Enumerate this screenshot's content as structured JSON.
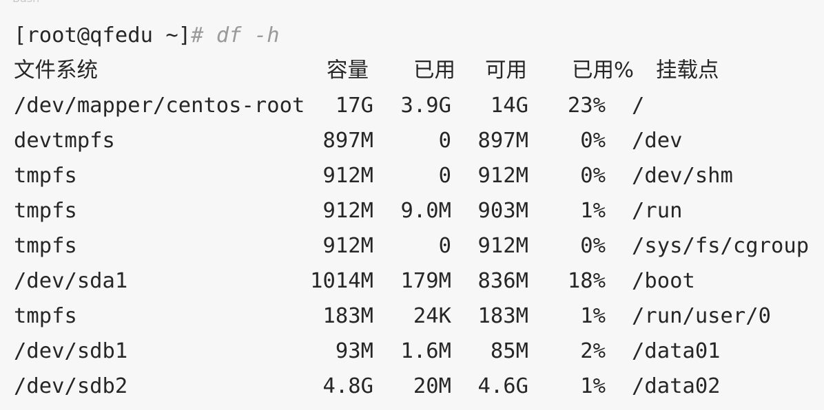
{
  "language_label": "Bash",
  "prompt": {
    "user_host": "[root@qfedu ~]",
    "hash": "#",
    "command": "df -h"
  },
  "table": {
    "headers": {
      "filesystem": "文件系统",
      "size": "容量",
      "used": "已用",
      "avail": "可用",
      "use_pct": "已用%",
      "mounted_on": "挂载点"
    },
    "rows": [
      {
        "filesystem": "/dev/mapper/centos-root",
        "size": "17G",
        "used": "3.9G",
        "avail": "14G",
        "use_pct": "23%",
        "mounted_on": "/"
      },
      {
        "filesystem": "devtmpfs",
        "size": "897M",
        "used": "0",
        "avail": "897M",
        "use_pct": "0%",
        "mounted_on": "/dev"
      },
      {
        "filesystem": "tmpfs",
        "size": "912M",
        "used": "0",
        "avail": "912M",
        "use_pct": "0%",
        "mounted_on": "/dev/shm"
      },
      {
        "filesystem": "tmpfs",
        "size": "912M",
        "used": "9.0M",
        "avail": "903M",
        "use_pct": "1%",
        "mounted_on": "/run"
      },
      {
        "filesystem": "tmpfs",
        "size": "912M",
        "used": "0",
        "avail": "912M",
        "use_pct": "0%",
        "mounted_on": "/sys/fs/cgroup"
      },
      {
        "filesystem": "/dev/sda1",
        "size": "1014M",
        "used": "179M",
        "avail": "836M",
        "use_pct": "18%",
        "mounted_on": "/boot"
      },
      {
        "filesystem": "tmpfs",
        "size": "183M",
        "used": "24K",
        "avail": "183M",
        "use_pct": "1%",
        "mounted_on": "/run/user/0"
      },
      {
        "filesystem": "/dev/sdb1",
        "size": "93M",
        "used": "1.6M",
        "avail": "85M",
        "use_pct": "2%",
        "mounted_on": "/data01"
      },
      {
        "filesystem": "/dev/sdb2",
        "size": "4.8G",
        "used": "20M",
        "avail": "4.6G",
        "use_pct": "1%",
        "mounted_on": "/data02"
      }
    ]
  }
}
